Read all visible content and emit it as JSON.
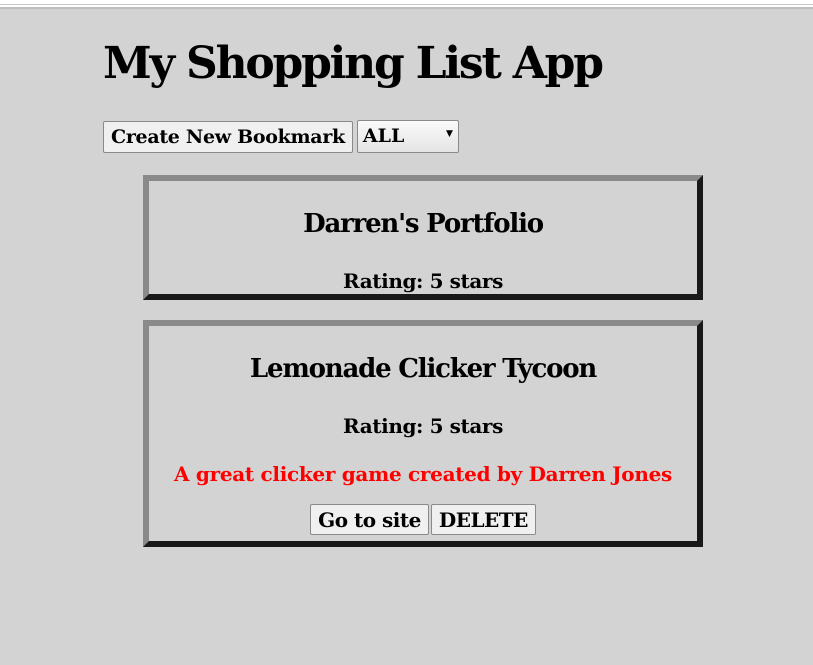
{
  "app": {
    "title": "My Shopping List App"
  },
  "controls": {
    "create_label": "Create New Bookmark",
    "filter_selected": "ALL"
  },
  "bookmarks": [
    {
      "title": "Darren's Portfolio",
      "rating": "Rating: 5 stars"
    },
    {
      "title": "Lemonade Clicker Tycoon",
      "rating": "Rating: 5 stars",
      "description": "A great clicker game created by Darren Jones",
      "visit_label": "Go to site",
      "delete_label": "DELETE"
    }
  ],
  "colors": {
    "background": "#d3d3d3",
    "description_text": "#ff0000"
  }
}
